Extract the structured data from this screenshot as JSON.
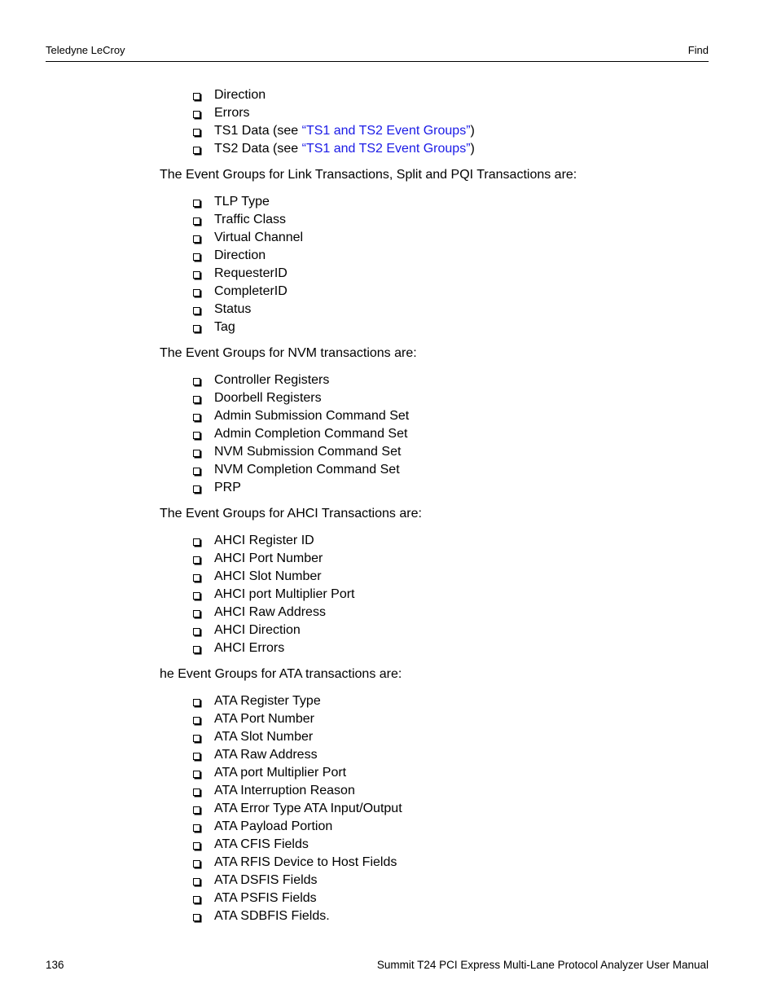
{
  "header": {
    "left": "Teledyne LeCroy",
    "right": "Find"
  },
  "footer": {
    "page_number": "136",
    "title": "Summit T24 PCI Express Multi-Lane Protocol Analyzer User Manual"
  },
  "intro_list": [
    {
      "text": "Direction"
    },
    {
      "text": "Errors"
    },
    {
      "prefix": "TS1 Data (see ",
      "link": "“TS1 and TS2 Event Groups”",
      "suffix": ")"
    },
    {
      "prefix": "TS2 Data (see ",
      "link": "“TS1 and TS2 Event Groups”",
      "suffix": ")"
    }
  ],
  "sections": [
    {
      "heading": "The Event Groups for Link Transactions, Split and PQI Transactions are:",
      "items": [
        "TLP Type",
        "Traffic Class",
        "Virtual Channel",
        "Direction",
        "RequesterID",
        "CompleterID",
        "Status",
        "Tag"
      ]
    },
    {
      "heading": "The Event Groups for NVM transactions are:",
      "items": [
        "Controller Registers",
        "Doorbell Registers",
        "Admin Submission Command Set",
        "Admin Completion Command Set",
        "NVM Submission Command Set",
        "NVM Completion Command Set",
        "PRP"
      ]
    },
    {
      "heading": "The Event Groups for AHCI Transactions are:",
      "items": [
        "AHCI Register ID",
        "AHCI Port Number",
        "AHCI Slot Number",
        "AHCI port Multiplier Port",
        "AHCI Raw Address",
        "AHCI Direction",
        "AHCI Errors"
      ]
    },
    {
      "heading": "he Event Groups for ATA transactions are:",
      "items": [
        "ATA Register Type",
        "ATA Port Number",
        "ATA Slot Number",
        "ATA Raw Address",
        "ATA port Multiplier Port",
        "ATA Interruption Reason",
        "ATA Error Type ATA Input/Output",
        "ATA Payload Portion",
        "ATA CFIS Fields",
        "ATA RFIS Device to Host Fields",
        "ATA DSFIS Fields",
        "ATA PSFIS Fields",
        "ATA SDBFIS Fields."
      ]
    }
  ],
  "colors": {
    "link": "#1a1ae6",
    "text": "#000000"
  }
}
